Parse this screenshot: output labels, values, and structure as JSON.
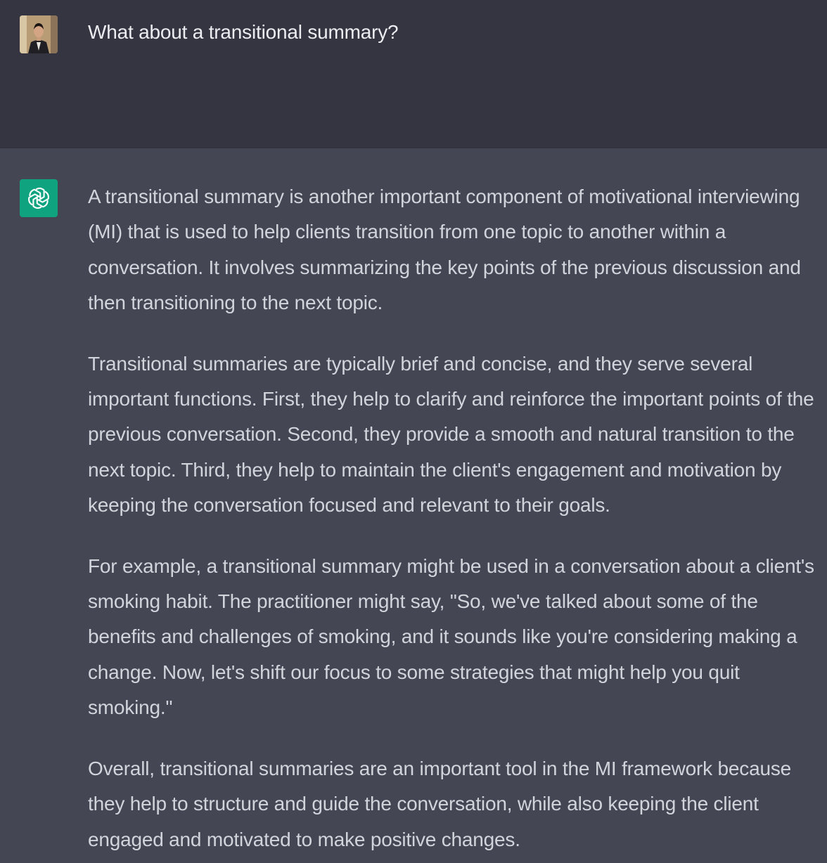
{
  "conversation": {
    "user_message": {
      "text": "What about a transitional summary?",
      "avatar_icon": "user-photo-avatar"
    },
    "assistant_message": {
      "avatar_icon": "openai-logo-icon",
      "avatar_color": "#10a37f",
      "paragraphs": [
        "A transitional summary is another important component of motivational interviewing (MI) that is used to help clients transition from one topic to another within a conversation. It involves summarizing the key points of the previous discussion and then transitioning to the next topic.",
        "Transitional summaries are typically brief and concise, and they serve several important functions. First, they help to clarify and reinforce the important points of the previous conversation. Second, they provide a smooth and natural transition to the next topic. Third, they help to maintain the client's engagement and motivation by keeping the conversation focused and relevant to their goals.",
        "For example, a transitional summary might be used in a conversation about a client's smoking habit. The practitioner might say, \"So, we've talked about some of the benefits and challenges of smoking, and it sounds like you're considering making a change. Now, let's shift our focus to some strategies that might help you quit smoking.\"",
        "Overall, transitional summaries are an important tool in the MI framework because they help to structure and guide the conversation, while also keeping the client engaged and motivated to make positive changes."
      ]
    }
  },
  "colors": {
    "user_row_bg": "#343541",
    "assistant_row_bg": "#444654",
    "text": "#d1d5db"
  }
}
